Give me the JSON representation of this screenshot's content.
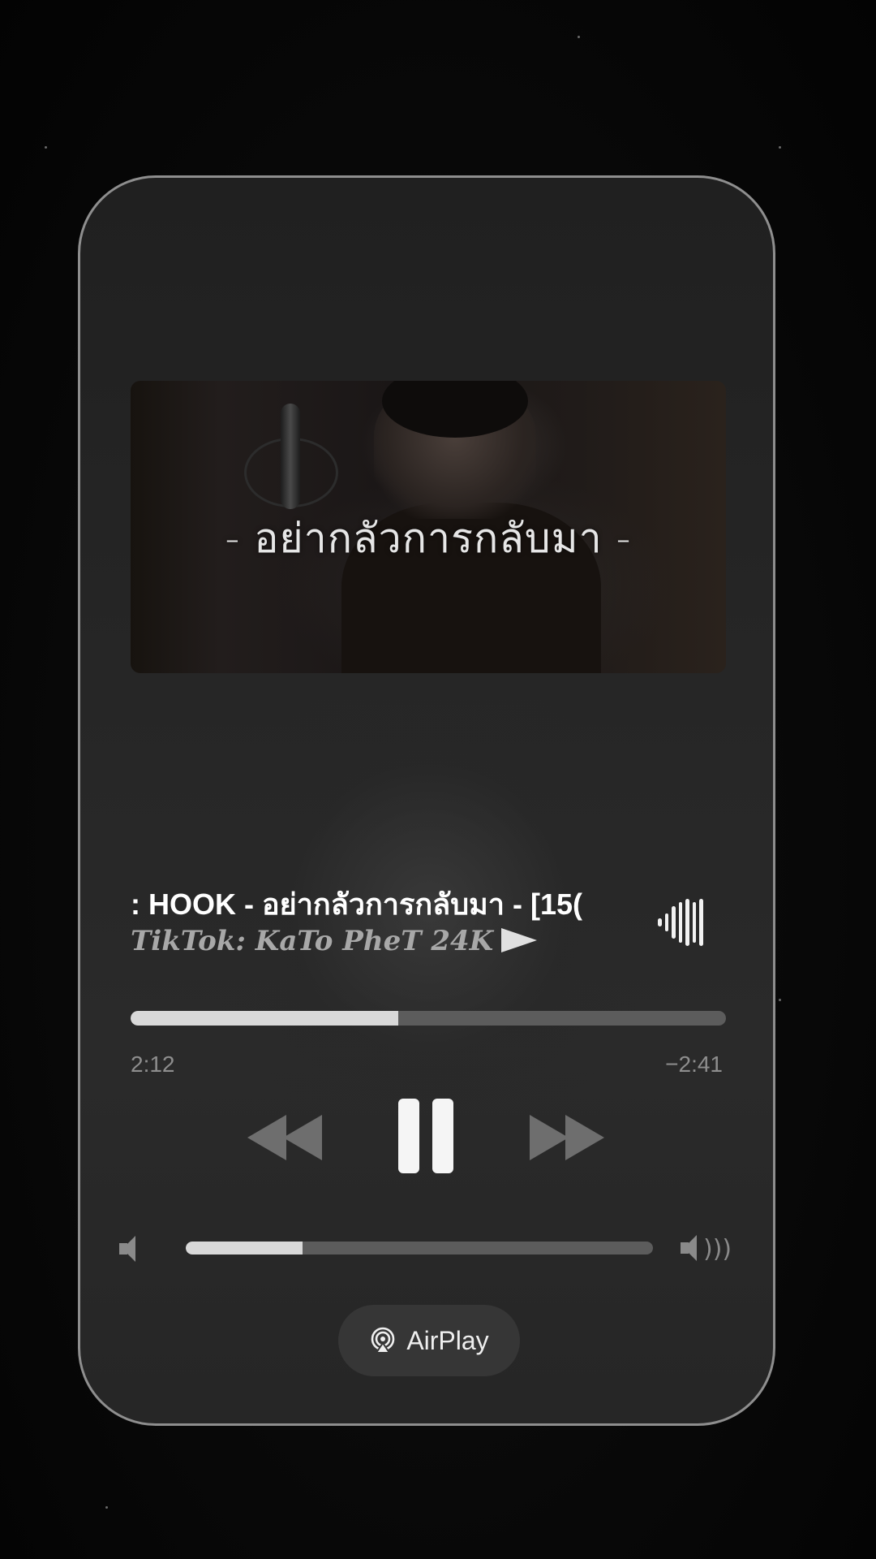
{
  "artwork": {
    "overlay_text": "-  อย่ากลัวการกลับมา  -"
  },
  "track": {
    "title": ": HOOK - อย่ากลัวการกลับมา - [15(",
    "artist": "TikTok: KaTo PheT 24K"
  },
  "playback": {
    "elapsed": "2:12",
    "remaining": "−2:41",
    "progress_fraction": 0.45,
    "state": "playing"
  },
  "volume": {
    "level_fraction": 0.25
  },
  "airplay": {
    "label": "AirPlay"
  },
  "icons": {
    "rewind": "rewind-icon",
    "pause": "pause-icon",
    "forward": "fast-forward-icon",
    "volume_low": "speaker-low-icon",
    "volume_high": "speaker-high-icon",
    "waveform": "waveform-icon",
    "airplay": "airplay-icon",
    "flag": "flag-icon"
  },
  "colors": {
    "card_border": "#8e8e8e",
    "progress_fill": "#d9d9d9",
    "track_bg": "#5c5c5c"
  }
}
